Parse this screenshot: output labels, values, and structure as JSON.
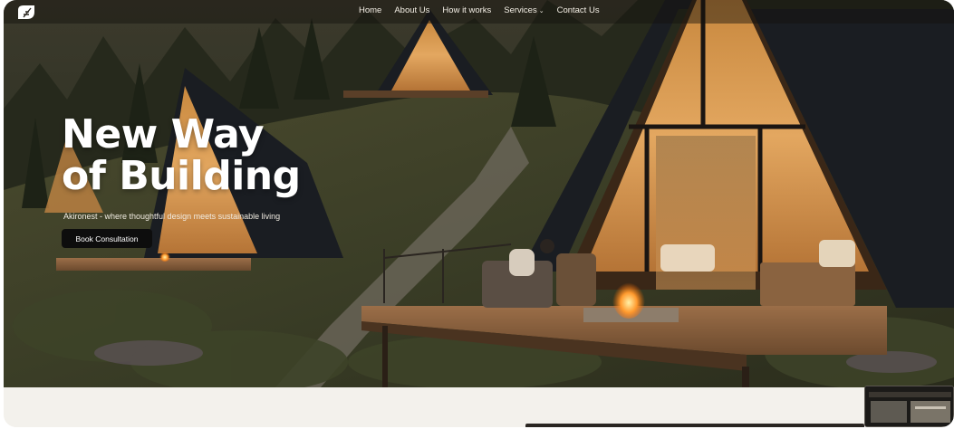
{
  "nav": {
    "items": [
      "Home",
      "About Us",
      "How it works",
      "Services",
      "Contact Us"
    ],
    "services_caret": "⌄"
  },
  "hero": {
    "headline_line1": "New Way",
    "headline_line2": "of Building",
    "subheading": "Akironest - where thoughtful design meets sustainable living",
    "cta_label": "Book Consultation"
  },
  "colors": {
    "cta_bg": "#0d0d0d",
    "roof": "#1c1f24",
    "warm_glow": "#e7a355",
    "forest": "#2c3322"
  },
  "icons": {
    "logo": "leaf-logo-icon",
    "preview": "video-thumbnail"
  }
}
